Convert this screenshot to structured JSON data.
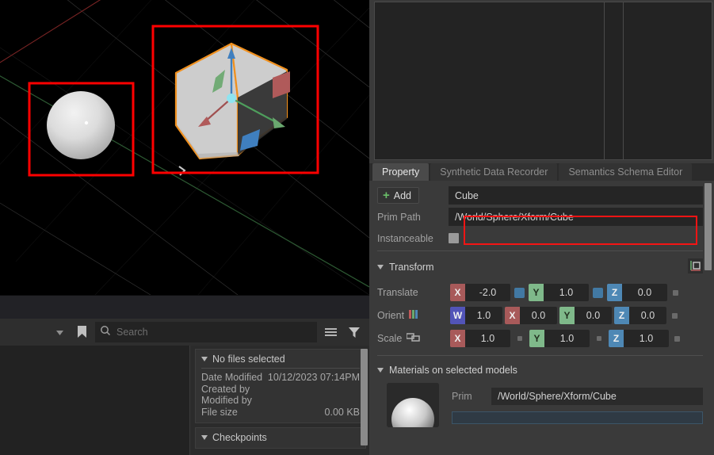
{
  "viewport": {
    "name": "3d-viewport",
    "background": "#000000",
    "objects": [
      {
        "name": "Sphere",
        "type": "sphere",
        "selection_box": "#ff0000"
      },
      {
        "name": "Cube",
        "type": "cube",
        "selection_box": "#ff0000",
        "outline": "#f0901e",
        "gizmo": "translate"
      }
    ],
    "gizmo_colors": {
      "x": "#b05a5a",
      "y": "#6aa86f",
      "z": "#3f7fbf",
      "center": "#8fe4f0"
    }
  },
  "file_browser": {
    "search": {
      "placeholder": "Search",
      "value": ""
    },
    "icons": {
      "dropdown": "chevron-down-icon",
      "bookmark": "bookmark-icon",
      "search": "search-icon",
      "list": "list-view-icon",
      "filter": "filter-icon"
    },
    "detail": {
      "title": "No files selected",
      "rows": [
        {
          "label": "Date Modified",
          "value": "10/12/2023 07:14PM"
        },
        {
          "label": "Created by",
          "value": ""
        },
        {
          "label": "Modified by",
          "value": ""
        },
        {
          "label": "File size",
          "value": "0.00 KB"
        }
      ],
      "checkpoints_title": "Checkpoints"
    }
  },
  "property_panel": {
    "tabs": [
      {
        "label": "Property",
        "active": true
      },
      {
        "label": "Synthetic Data Recorder",
        "active": false
      },
      {
        "label": "Semantics Schema Editor",
        "active": false
      }
    ],
    "add_button": "Add",
    "name_field": "Cube",
    "prim_path_label": "Prim Path",
    "prim_path_value": "/World/Sphere/Xform/Cube",
    "instanceable_label": "Instanceable",
    "instanceable_checked": true,
    "transform": {
      "title": "Transform",
      "pivot_icon": "axis-pivot-icon",
      "rows": [
        {
          "label": "Translate",
          "icon": "",
          "highlighted": true,
          "components": [
            {
              "axis": "X",
              "value": "-2.0"
            },
            {
              "axis": "Y",
              "value": "1.0"
            },
            {
              "axis": "Z",
              "value": "0.0"
            }
          ]
        },
        {
          "label": "Orient",
          "icon": "rgb-bars-icon",
          "highlighted": false,
          "components": [
            {
              "axis": "W",
              "value": "1.0"
            },
            {
              "axis": "X",
              "value": "0.0"
            },
            {
              "axis": "Y",
              "value": "0.0"
            },
            {
              "axis": "Z",
              "value": "0.0"
            }
          ]
        },
        {
          "label": "Scale",
          "icon": "link-icon",
          "highlighted": false,
          "components": [
            {
              "axis": "X",
              "value": "1.0"
            },
            {
              "axis": "Y",
              "value": "1.0"
            },
            {
              "axis": "Z",
              "value": "1.0"
            }
          ]
        }
      ]
    },
    "materials": {
      "title": "Materials on selected models",
      "prim_label": "Prim",
      "prim_value": "/World/Sphere/Xform/Cube"
    }
  },
  "colors": {
    "accent_red": "#f41414",
    "axis_x": "#a85a5a",
    "axis_y": "#7fb98a",
    "axis_z": "#4e88b5",
    "axis_w": "#5254b8",
    "add_plus": "#6abf69",
    "panel_bg": "#3a3a3a",
    "field_bg": "#252525"
  }
}
